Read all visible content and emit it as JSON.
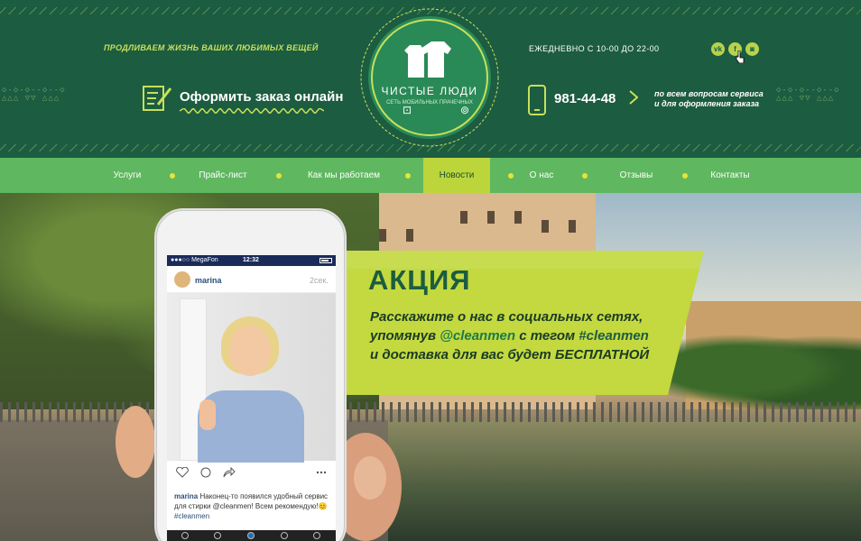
{
  "header": {
    "tagline": "ПРОДЛИВАЕМ ЖИЗНЬ ВАШИХ ЛЮБИМЫХ ВЕЩЕЙ",
    "order_label": "Оформить заказ онлайн",
    "logo_title": "ЧИСТЫЕ ЛЮДИ",
    "logo_subtitle": "СЕТЬ МОБИЛЬНЫХ ПРАЧЕЧНЫХ",
    "hours": "ЕЖЕДНЕВНО С 10-00 ДО 22-00",
    "phone": "981-44-48",
    "phone_note_line1": "по всем вопросам сервиса",
    "phone_note_line2": "и для оформления заказа",
    "social": [
      {
        "icon": "vk-icon",
        "glyph": "vk"
      },
      {
        "icon": "facebook-icon",
        "glyph": "f"
      },
      {
        "icon": "instagram-icon",
        "glyph": "◙"
      }
    ]
  },
  "nav": {
    "items": [
      {
        "label": "Услуги"
      },
      {
        "label": "Прайс-лист"
      },
      {
        "label": "Как мы работаем"
      },
      {
        "label": "Новости",
        "active": true
      },
      {
        "label": "О нас"
      },
      {
        "label": "Отзывы"
      },
      {
        "label": "Контакты"
      }
    ]
  },
  "promo": {
    "title": "АКЦИЯ",
    "text_1": "Расскажите о нас в социальных сетях, упомянув ",
    "mention": "@cleanmen",
    "text_2": " с тегом ",
    "hashtag": "#cleanmen",
    "text_3": " и доставка для вас будет ",
    "text_4": "БЕСПЛАТНОЙ"
  },
  "phone_mock": {
    "carrier": "●●●○○ MegaFon",
    "time": "12:32",
    "user": "marina",
    "ago": "2сек.",
    "caption_user": "marina",
    "caption_text": "Наконец-то появился удобный сервис для стирки @cleanmen! Всем рекомендую!😊 ",
    "caption_tag": "#cleanmen"
  },
  "colors": {
    "header_bg": "#1c5c41",
    "nav_bg": "#5fb760",
    "accent": "#bcd53b",
    "promo_title": "#1c5c41"
  }
}
